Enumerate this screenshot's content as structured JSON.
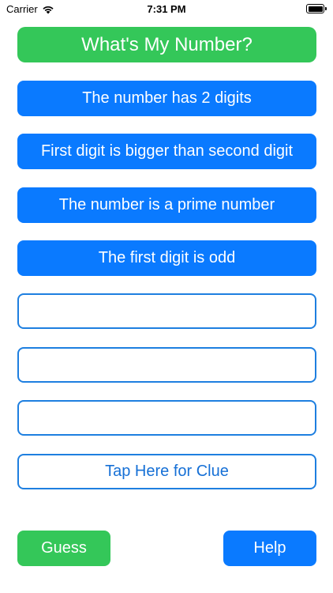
{
  "status_bar": {
    "carrier": "Carrier",
    "time": "7:31 PM"
  },
  "title": "What's My Number?",
  "clues": [
    "The number has 2 digits",
    "First digit is bigger than second digit",
    "The number is a prime number",
    "The first digit is odd",
    "",
    "",
    ""
  ],
  "tap_clue_label": "Tap Here for Clue",
  "buttons": {
    "guess": "Guess",
    "help": "Help"
  },
  "colors": {
    "green": "#34c759",
    "blue": "#0a7aff",
    "outline_blue": "#1e7fe0"
  },
  "icons": [
    "wifi-icon",
    "battery-icon"
  ]
}
